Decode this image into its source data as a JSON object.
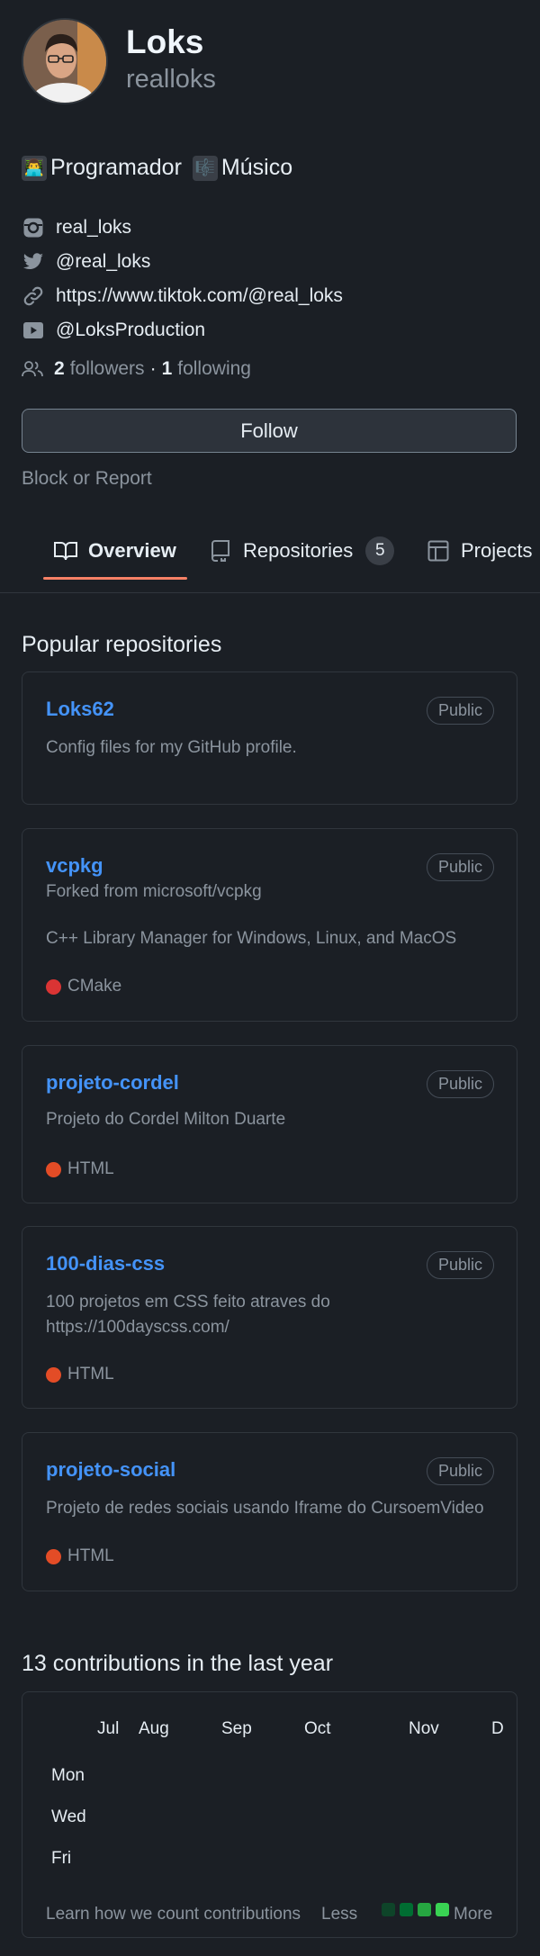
{
  "profile": {
    "name": "Loks",
    "username": "realloks",
    "bio_emoji_1": "👨‍💻",
    "bio_text_1": "Programador",
    "bio_emoji_2": "🎼",
    "bio_text_2": "Músico"
  },
  "links": [
    {
      "icon": "instagram-icon",
      "text": "real_loks"
    },
    {
      "icon": "twitter-icon",
      "text": "@real_loks"
    },
    {
      "icon": "link-icon",
      "text": "https://www.tiktok.com/@real_loks"
    },
    {
      "icon": "youtube-icon",
      "text": "@LoksProduction"
    }
  ],
  "followers": {
    "followers_count": "2",
    "followers_label": "followers",
    "separator": "·",
    "following_count": "1",
    "following_label": "following"
  },
  "actions": {
    "follow_label": "Follow",
    "block_label": "Block or Report"
  },
  "tabs": [
    {
      "icon": "book-icon",
      "label": "Overview",
      "active": true
    },
    {
      "icon": "repo-icon",
      "label": "Repositories",
      "count": "5"
    },
    {
      "icon": "table-icon",
      "label": "Projects"
    }
  ],
  "popular": {
    "title": "Popular repositories",
    "repos": [
      {
        "name": "Loks62",
        "visibility": "Public",
        "desc": "Config files for my GitHub profile."
      },
      {
        "name": "vcpkg",
        "visibility": "Public",
        "forked": "Forked from microsoft/vcpkg",
        "desc": "C++ Library Manager for Windows, Linux, and MacOS",
        "language": "CMake",
        "language_color": "#da3434"
      },
      {
        "name": "projeto-cordel",
        "visibility": "Public",
        "desc": "Projeto do Cordel Milton Duarte",
        "language": "HTML",
        "language_color": "#e34c26"
      },
      {
        "name": "100-dias-css",
        "visibility": "Public",
        "desc": "100 projetos em CSS feito atraves do https://100dayscss.com/",
        "language": "HTML",
        "language_color": "#e34c26"
      },
      {
        "name": "projeto-social",
        "visibility": "Public",
        "desc": "Projeto de redes sociais usando Iframe do CursoemVideo",
        "language": "HTML",
        "language_color": "#e34c26"
      }
    ]
  },
  "contributions": {
    "title": "13 contributions in the last year",
    "months": [
      "Jul",
      "Aug",
      "Sep",
      "Oct",
      "Nov",
      "D"
    ],
    "days": [
      "Mon",
      "Wed",
      "Fri"
    ],
    "learn": "Learn how we count contributions",
    "less": "Less",
    "more": "More",
    "legend_colors": [
      "#0e4429",
      "#006d32",
      "#26a641",
      "#39d353"
    ]
  }
}
